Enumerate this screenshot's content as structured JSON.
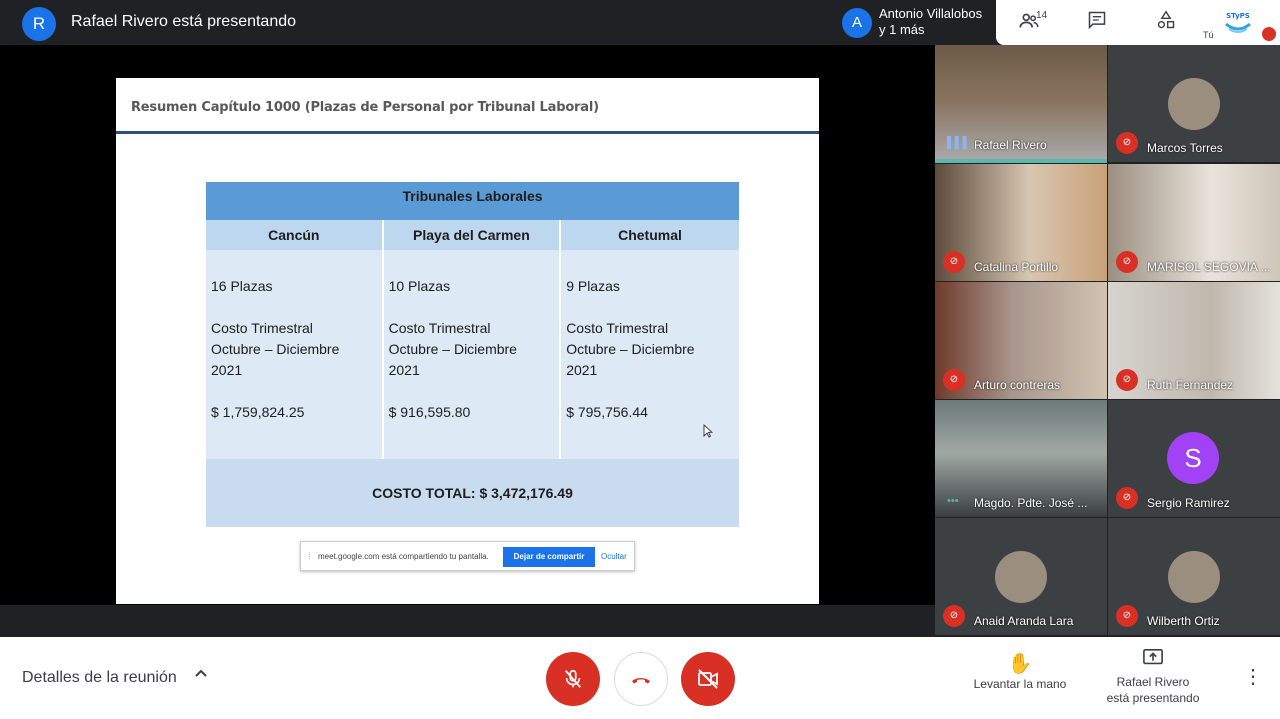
{
  "top_bar": {
    "presenter_initial": "R",
    "presenter_title": "Rafael Rivero está presentando",
    "speaker_initial": "A",
    "speaker_name_line1": "Antonio Villalobos",
    "speaker_name_line2": "y 1 más",
    "people_count": "14",
    "self_label": "Tú",
    "self_logo_text": "STyPS"
  },
  "slide": {
    "title": "Resumen Capítulo 1000 (Plazas de Personal por Tribunal Laboral)",
    "table_header": "Tribunales Laborales",
    "columns": [
      {
        "name": "Cancún",
        "plazas": "16 Plazas",
        "costo_label": "Costo Trimestral",
        "periodo": "Octubre – Diciembre",
        "anio": "2021",
        "monto": "$ 1,759,824.25"
      },
      {
        "name": "Playa del Carmen",
        "plazas": "10 Plazas",
        "costo_label": "Costo Trimestral",
        "periodo": "Octubre – Diciembre",
        "anio": "2021",
        "monto": "$ 916,595.80"
      },
      {
        "name": "Chetumal",
        "plazas": "9 Plazas",
        "costo_label": "Costo Trimestral",
        "periodo": "Octubre – Diciembre",
        "anio": "2021",
        "monto": "$ 795,756.44"
      }
    ],
    "total": "COSTO TOTAL: $ 3,472,176.49"
  },
  "share_bar": {
    "text": "meet.google.com está compartiendo tu pantalla.",
    "stop_label": "Dejar de compartir",
    "hide_label": "Ocultar"
  },
  "participants": [
    {
      "name": "Rafael Rivero"
    },
    {
      "name": "Marcos Torres"
    },
    {
      "name": "Catalina Portillo"
    },
    {
      "name": "MARISOL SEGOVIA ..."
    },
    {
      "name": "Arturo contreras"
    },
    {
      "name": "Ruth Fernandez"
    },
    {
      "name": "Magdo. Pdte. José ..."
    },
    {
      "name": "Sergio Ramirez",
      "initial": "S"
    },
    {
      "name": "Anaid Aranda Lara"
    },
    {
      "name": "Wilberth Ortiz"
    }
  ],
  "bottom_bar": {
    "details_label": "Detalles de la reunión",
    "raise_hand_label": "Levantar la mano",
    "presenting_line1": "Rafael Rivero",
    "presenting_line2": "está presentando"
  },
  "colors": {
    "accent": "#1a73e8",
    "danger": "#d93025",
    "table_header": "#5b9bd5",
    "table_colhead": "#bdd7ee"
  }
}
